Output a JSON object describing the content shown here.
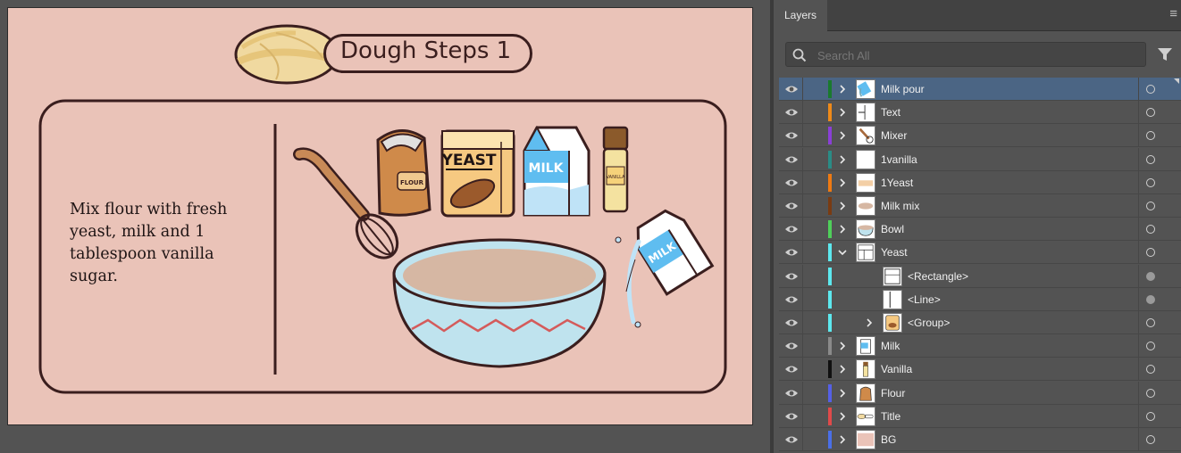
{
  "artboard": {
    "title": "Dough Steps 1",
    "instruction": "Mix flour with fresh\nyeast, milk and 1\ntablespoon vanilla\nsugar.",
    "labels": {
      "flour": "FLOUR",
      "yeast": "YEAST",
      "milk": "MILK",
      "vanilla": "VANILLA",
      "milk_pour": "MILK"
    }
  },
  "panel": {
    "tab": "Layers",
    "search_placeholder": "Search All",
    "layers": [
      {
        "name": "Milk pour",
        "color": "#1a7a2e",
        "level": 0,
        "expanded": false,
        "selected": true,
        "target": "open",
        "thumb": "milk-pour"
      },
      {
        "name": "Text",
        "color": "#ef8a19",
        "level": 0,
        "expanded": false,
        "selected": false,
        "target": "open",
        "thumb": "text"
      },
      {
        "name": "Mixer",
        "color": "#8a3fd6",
        "level": 0,
        "expanded": false,
        "selected": false,
        "target": "open",
        "thumb": "mixer"
      },
      {
        "name": "1vanilla",
        "color": "#2a8c86",
        "level": 0,
        "expanded": false,
        "selected": false,
        "target": "open",
        "thumb": "blank"
      },
      {
        "name": "1Yeast",
        "color": "#ef7a12",
        "level": 0,
        "expanded": false,
        "selected": false,
        "target": "open",
        "thumb": "yeast-mini"
      },
      {
        "name": "Milk mix",
        "color": "#7a3b12",
        "level": 0,
        "expanded": false,
        "selected": false,
        "target": "open",
        "thumb": "milk-mix"
      },
      {
        "name": "Bowl",
        "color": "#4fcf5a",
        "level": 0,
        "expanded": false,
        "selected": false,
        "target": "open",
        "thumb": "bowl"
      },
      {
        "name": "Yeast",
        "color": "#5de8ee",
        "level": 0,
        "expanded": true,
        "selected": false,
        "target": "open",
        "thumb": "yeast"
      },
      {
        "name": "<Rectangle>",
        "color": "#5de8ee",
        "level": 1,
        "expanded": null,
        "selected": false,
        "target": "filled",
        "thumb": "rect"
      },
      {
        "name": "<Line>",
        "color": "#5de8ee",
        "level": 1,
        "expanded": null,
        "selected": false,
        "target": "filled",
        "thumb": "line"
      },
      {
        "name": "<Group>",
        "color": "#5de8ee",
        "level": 1,
        "expanded": false,
        "selected": false,
        "target": "open",
        "thumb": "group"
      },
      {
        "name": "Milk",
        "color": "#8a8a8a",
        "level": 0,
        "expanded": false,
        "selected": false,
        "target": "open",
        "thumb": "milk"
      },
      {
        "name": "Vanilla",
        "color": "#101010",
        "level": 0,
        "expanded": false,
        "selected": false,
        "target": "open",
        "thumb": "vanilla"
      },
      {
        "name": "Flour",
        "color": "#5560e6",
        "level": 0,
        "expanded": false,
        "selected": false,
        "target": "open",
        "thumb": "flour"
      },
      {
        "name": "Title",
        "color": "#e04a4a",
        "level": 0,
        "expanded": false,
        "selected": false,
        "target": "open",
        "thumb": "title"
      },
      {
        "name": "BG",
        "color": "#4a6fe8",
        "level": 0,
        "expanded": false,
        "selected": false,
        "target": "open",
        "thumb": "bg"
      }
    ]
  }
}
